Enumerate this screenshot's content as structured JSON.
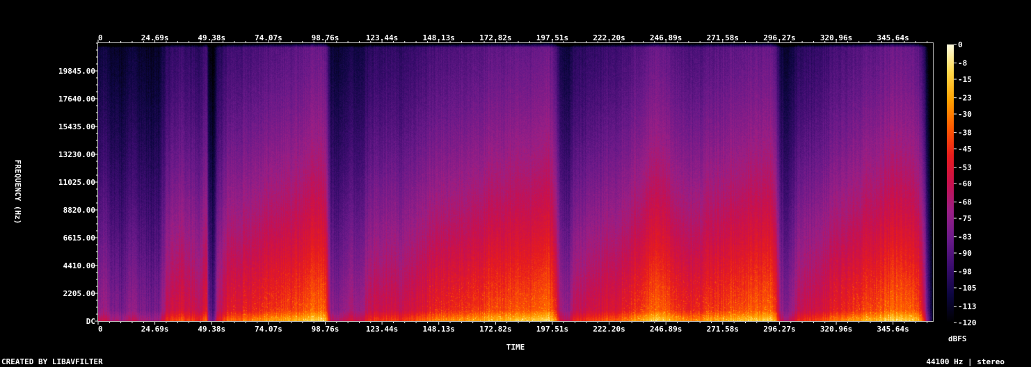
{
  "chart_data": {
    "type": "heatmap",
    "xlabel": "TIME",
    "ylabel": "FREQUENCY (Hz)",
    "x_ticks": [
      "0",
      "24.69s",
      "49.38s",
      "74.07s",
      "98.76s",
      "123.44s",
      "148.13s",
      "172.82s",
      "197.51s",
      "222.20s",
      "246.89s",
      "271.58s",
      "296.27s",
      "320.96s",
      "345.64s"
    ],
    "x_tick_values": [
      0,
      24.69,
      49.38,
      74.07,
      98.76,
      123.44,
      148.13,
      172.82,
      197.51,
      222.2,
      246.89,
      271.58,
      296.27,
      320.96,
      345.64
    ],
    "xlim": [
      0,
      363
    ],
    "y_ticks": [
      "DC",
      "2205.00",
      "4410.00",
      "6615.00",
      "8820.00",
      "11025.00",
      "13230.00",
      "15435.00",
      "17640.00",
      "19845.00"
    ],
    "y_tick_values": [
      0,
      2205,
      4410,
      6615,
      8820,
      11025,
      13230,
      15435,
      17640,
      19845
    ],
    "ylim": [
      0,
      22050
    ],
    "colorbar": {
      "label": "dBFS",
      "ticks": [
        "0",
        "-8",
        "-15",
        "-23",
        "-30",
        "-38",
        "-45",
        "-53",
        "-60",
        "-68",
        "-75",
        "-83",
        "-90",
        "-98",
        "-105",
        "-113",
        "-120"
      ],
      "range": [
        -120,
        0
      ],
      "colormap": [
        "#000000",
        "#0c0640",
        "#3a0c6e",
        "#6a1a8a",
        "#9a1f86",
        "#c8104e",
        "#e81c1c",
        "#ff5a00",
        "#ffa200",
        "#ffd84a",
        "#fffde0"
      ]
    },
    "loudness_profile": [
      [
        0,
        0.45
      ],
      [
        3,
        0.5
      ],
      [
        6,
        0.42
      ],
      [
        10,
        0.38
      ],
      [
        14,
        0.48
      ],
      [
        20,
        0.4
      ],
      [
        26,
        0.38
      ],
      [
        30,
        0.6
      ],
      [
        35,
        0.66
      ],
      [
        40,
        0.62
      ],
      [
        44,
        0.58
      ],
      [
        47,
        0.7
      ],
      [
        48,
        0.35
      ],
      [
        50,
        0.28
      ],
      [
        52,
        0.55
      ],
      [
        56,
        0.68
      ],
      [
        62,
        0.7
      ],
      [
        66,
        0.72
      ],
      [
        70,
        0.74
      ],
      [
        76,
        0.76
      ],
      [
        82,
        0.78
      ],
      [
        88,
        0.8
      ],
      [
        92,
        0.84
      ],
      [
        96,
        0.86
      ],
      [
        99,
        0.82
      ],
      [
        101,
        0.45
      ],
      [
        104,
        0.42
      ],
      [
        107,
        0.5
      ],
      [
        110,
        0.52
      ],
      [
        113,
        0.48
      ],
      [
        116,
        0.55
      ],
      [
        120,
        0.62
      ],
      [
        126,
        0.64
      ],
      [
        132,
        0.6
      ],
      [
        138,
        0.66
      ],
      [
        144,
        0.7
      ],
      [
        150,
        0.72
      ],
      [
        156,
        0.74
      ],
      [
        162,
        0.76
      ],
      [
        168,
        0.78
      ],
      [
        174,
        0.8
      ],
      [
        180,
        0.82
      ],
      [
        186,
        0.8
      ],
      [
        192,
        0.84
      ],
      [
        196,
        0.86
      ],
      [
        198,
        0.8
      ],
      [
        201,
        0.5
      ],
      [
        204,
        0.45
      ],
      [
        207,
        0.58
      ],
      [
        210,
        0.6
      ],
      [
        214,
        0.62
      ],
      [
        218,
        0.64
      ],
      [
        222,
        0.66
      ],
      [
        226,
        0.68
      ],
      [
        230,
        0.7
      ],
      [
        234,
        0.76
      ],
      [
        238,
        0.8
      ],
      [
        242,
        0.84
      ],
      [
        246,
        0.82
      ],
      [
        250,
        0.78
      ],
      [
        254,
        0.74
      ],
      [
        258,
        0.72
      ],
      [
        262,
        0.74
      ],
      [
        266,
        0.76
      ],
      [
        270,
        0.78
      ],
      [
        276,
        0.8
      ],
      [
        282,
        0.82
      ],
      [
        288,
        0.84
      ],
      [
        292,
        0.86
      ],
      [
        294,
        0.8
      ],
      [
        297,
        0.46
      ],
      [
        300,
        0.42
      ],
      [
        303,
        0.55
      ],
      [
        308,
        0.6
      ],
      [
        314,
        0.64
      ],
      [
        320,
        0.7
      ],
      [
        326,
        0.74
      ],
      [
        332,
        0.78
      ],
      [
        338,
        0.8
      ],
      [
        344,
        0.84
      ],
      [
        350,
        0.86
      ],
      [
        354,
        0.84
      ],
      [
        357,
        0.78
      ],
      [
        359,
        0.6
      ],
      [
        361,
        0.25
      ],
      [
        363,
        0.05
      ]
    ]
  },
  "footer": {
    "left_text": "CREATED BY LIBAVFILTER",
    "right_text": "44100 Hz | stereo"
  }
}
